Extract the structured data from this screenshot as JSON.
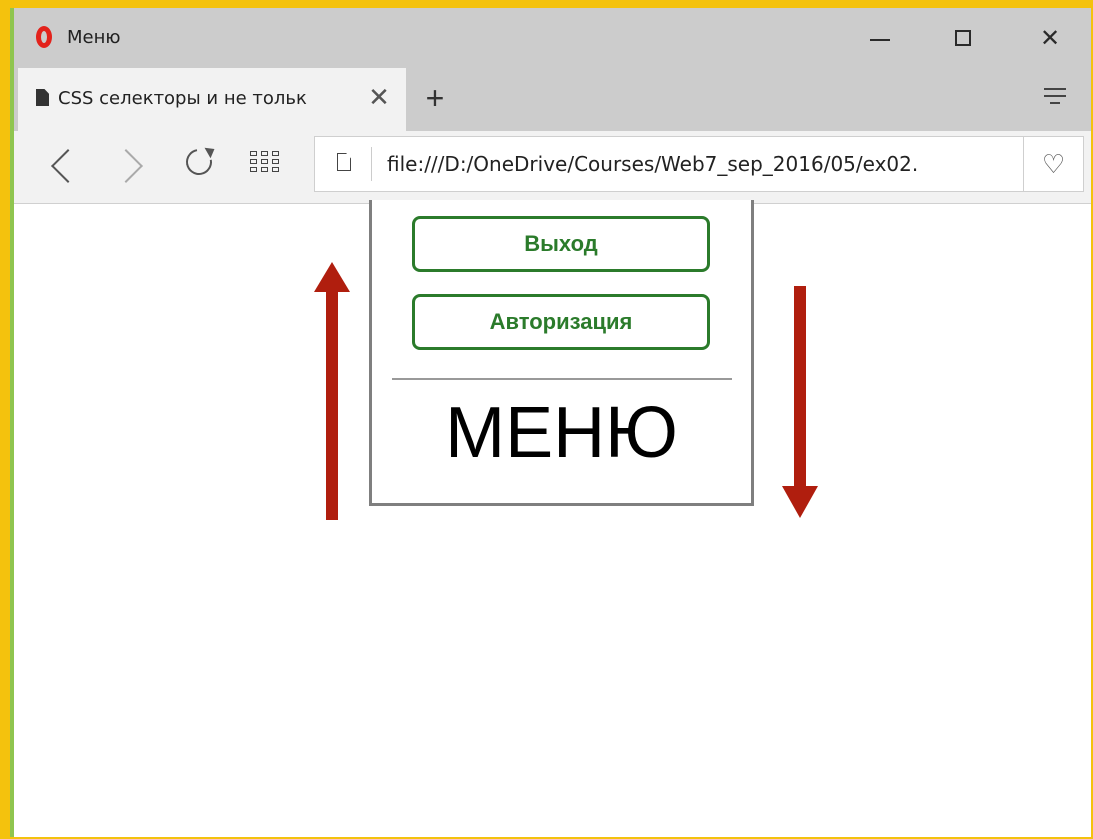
{
  "window": {
    "title": "Меню",
    "minimize_icon": "minimize-icon",
    "maximize_icon": "maximize-icon",
    "close_glyph": "✕"
  },
  "tabs": [
    {
      "title": "CSS селекторы и не тольк",
      "close_glyph": "✕",
      "active": true
    }
  ],
  "tabstrip": {
    "new_tab_glyph": "+",
    "menu_icon": "tab-menu-icon"
  },
  "toolbar": {
    "back_icon": "back-arrow-icon",
    "forward_icon": "forward-arrow-icon",
    "reload_icon": "reload-icon",
    "speed_dial_icon": "speed-dial-icon",
    "address": "file:///D:/OneDrive/Courses/Web7_sep_2016/05/ex02.",
    "bookmark_glyph": "♡"
  },
  "page": {
    "buttons": [
      {
        "label": "Выход"
      },
      {
        "label": "Авторизация"
      }
    ],
    "menu_title": "МЕНЮ",
    "button_color": "#2b7b2b",
    "arrow_color": "#b01e0e"
  },
  "colors": {
    "frame_accent": "#f4c20d",
    "opera_red": "#e3221b",
    "chrome_bg": "#cccccc"
  }
}
